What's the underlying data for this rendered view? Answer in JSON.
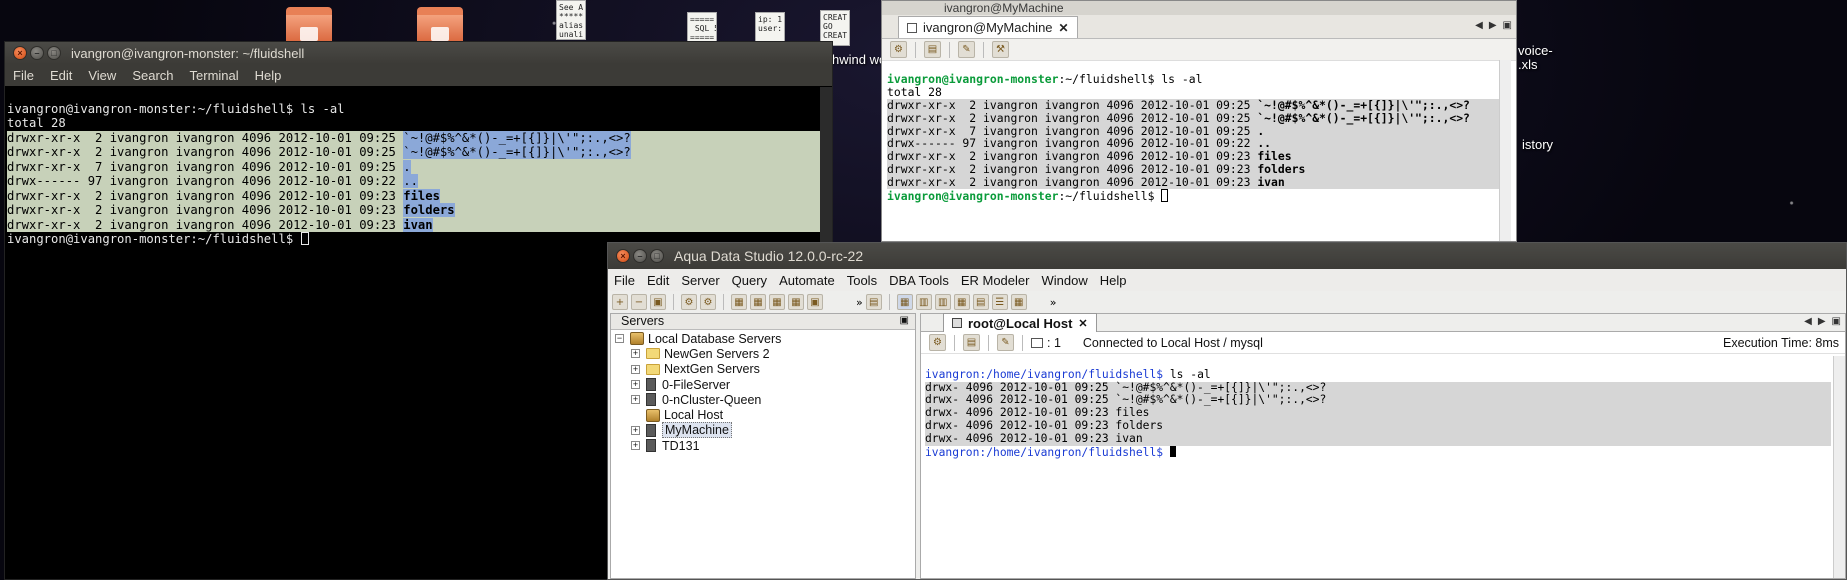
{
  "desktop": {
    "doc_icon_1_text": "See A\n*****\nalias\nunali",
    "doc_icon_2_text": "=====\n SQL 5\n=====",
    "doc_icon_3_text": "ip: 1\nuser:",
    "doc_icon_4_text": "CREAT\nGO\nCREAT",
    "label_whind": "hwind wo",
    "label_invoice": "voice-\n.xls",
    "label_history": "istory"
  },
  "terminal1": {
    "title": "ivangron@ivangron-monster: ~/fluidshell",
    "menu": [
      "File",
      "Edit",
      "View",
      "Search",
      "Terminal",
      "Help"
    ],
    "lines": {
      "cmd": "ivangron@ivangron-monster:~/fluidshell$ ls -al",
      "total": "total 28",
      "r1_meta": "drwxr-xr-x  2 ivangron ivangron 4096 2012-10-01 09:25 ",
      "r1_name": "`~!@#$%^&*()-_=+[{]}|\\'\";:.,<>?",
      "r2_meta": "drwxr-xr-x  2 ivangron ivangron 4096 2012-10-01 09:25 ",
      "r2_name": "`~!@#$%^&*()-_=+[{]}|\\'\";:.,<>?",
      "r3_meta": "drwxr-xr-x  7 ivangron ivangron 4096 2012-10-01 09:25 ",
      "r3_name": ".",
      "r4_meta": "drwx------ 97 ivangron ivangron 4096 2012-10-01 09:22 ",
      "r4_name": "..",
      "r5_meta": "drwxr-xr-x  2 ivangron ivangron 4096 2012-10-01 09:23 ",
      "r5_name": "files",
      "r6_meta": "drwxr-xr-x  2 ivangron ivangron 4096 2012-10-01 09:23 ",
      "r6_name": "folders",
      "r7_meta": "drwxr-xr-x  2 ivangron ivangron 4096 2012-10-01 09:23 ",
      "r7_name": "ivan",
      "prompt_end": "ivangron@ivangron-monster:~/fluidshell$ "
    }
  },
  "terminal2": {
    "title": "ivangron@MyMachine",
    "tab_label": "ivangron@MyMachine",
    "tab_close": "✕",
    "prompt": "ivangron@ivangron-monster",
    "prompt_path": ":~/fluidshell$ ",
    "cmd": "ls -al",
    "total": "total 28",
    "rows": [
      {
        "meta": "drwxr-xr-x  2 ivangron ivangron 4096 2012-10-01 09:25 ",
        "name": "`~!@#$%^&*()-_=+[{]}|\\'\";:.,<>?"
      },
      {
        "meta": "drwxr-xr-x  2 ivangron ivangron 4096 2012-10-01 09:25 ",
        "name": "`~!@#$%^&*()-_=+[{]}|\\'\";:.,<>?"
      },
      {
        "meta": "drwxr-xr-x  7 ivangron ivangron 4096 2012-10-01 09:25 ",
        "name": "."
      },
      {
        "meta": "drwx------ 97 ivangron ivangron 4096 2012-10-01 09:22 ",
        "name": ".."
      },
      {
        "meta": "drwxr-xr-x  2 ivangron ivangron 4096 2012-10-01 09:23 ",
        "name": "files"
      },
      {
        "meta": "drwxr-xr-x  2 ivangron ivangron 4096 2012-10-01 09:23 ",
        "name": "folders"
      },
      {
        "meta": "drwxr-xr-x  2 ivangron ivangron 4096 2012-10-01 09:23 ",
        "name": "ivan"
      }
    ]
  },
  "ads": {
    "title": "Aqua Data Studio 12.0.0-rc-22",
    "menu": [
      "File",
      "Edit",
      "Server",
      "Query",
      "Automate",
      "Tools",
      "DBA Tools",
      "ER Modeler",
      "Window",
      "Help"
    ],
    "servers_label": "Servers",
    "tree": [
      "Local Database Servers",
      "NewGen Servers 2",
      "NextGen Servers",
      "0-FileServer",
      "0-nCluster-Queen",
      "Local Host",
      "MyMachine",
      "TD131"
    ],
    "tab_label": "root@Local Host",
    "tab_close": "✕",
    "conn_count": ": 1",
    "connected": "Connected to Local Host / mysql",
    "exec_time": "Execution Time: 8ms",
    "console": {
      "prompt": "ivangron:/home/ivangron/fluidshell$ ",
      "cmd": "ls -al",
      "r1": "drwx- 4096 2012-10-01 09:25 `~!@#$%^&*()-_=+[{]}|\\'\";:.,<>?",
      "r2": "drwx- 4096 2012-10-01 09:25 `~!@#$%^&*()-_=+[{]}|\\'\";:.,<>?",
      "r3": "drwx- 4096 2012-10-01 09:23 files",
      "r4": "drwx- 4096 2012-10-01 09:23 folders",
      "r5": "drwx- 4096 2012-10-01 09:23 ivan"
    }
  },
  "colors": {
    "selection_green": "#c7d1b9",
    "highlight_blue": "#8ba8d8",
    "prompt_green": "#0a9b3a",
    "ads_prompt_blue": "#1a3bd4"
  }
}
